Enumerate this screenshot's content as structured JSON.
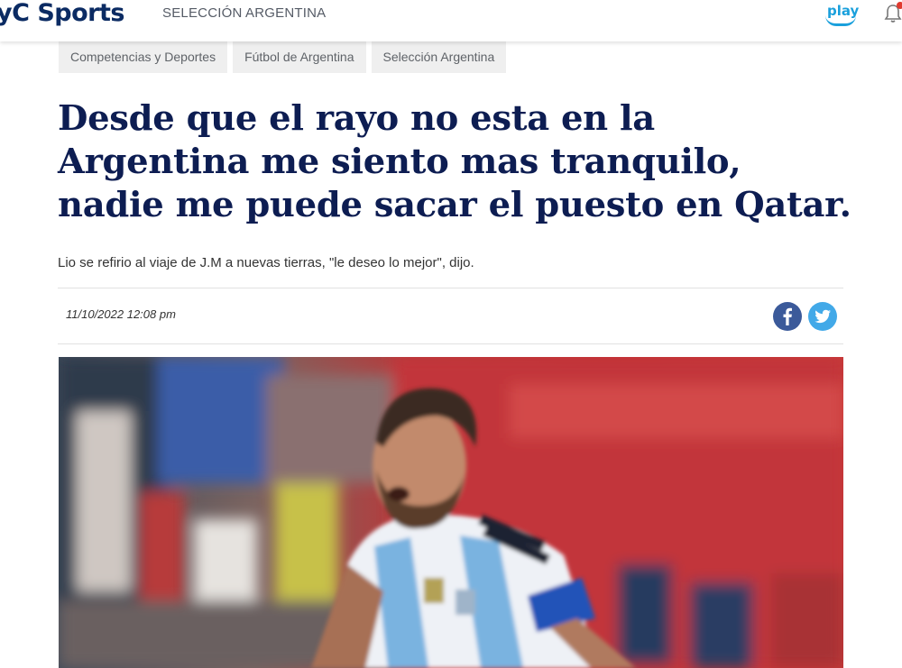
{
  "header": {
    "logo_text": "yC Sports",
    "section_title": "SELECCIÓN ARGENTINA",
    "play_label": "play"
  },
  "breadcrumb": [
    {
      "label": "Competencias y Deportes"
    },
    {
      "label": "Fútbol de Argentina"
    },
    {
      "label": "Selección Argentina"
    }
  ],
  "article": {
    "title": "Desde que el rayo no esta en la Argentina me siento mas tranquilo, nadie me puede sacar el puesto en Qatar.",
    "summary": "Lio se refirio al viaje de J.M a nuevas tierras, \"le deseo lo mejor\", dijo.",
    "date": "11/10/2022 12:08 pm"
  },
  "icons": {
    "share_facebook": "facebook-icon",
    "share_twitter": "twitter-icon",
    "notifications": "bell-icon"
  },
  "colors": {
    "brand_navy": "#0b2b63",
    "headline": "#0d1d52",
    "play_blue": "#1aa0dc",
    "facebook": "#3b5a9a",
    "twitter": "#42a9e8",
    "notification_dot": "#e03a2f"
  }
}
